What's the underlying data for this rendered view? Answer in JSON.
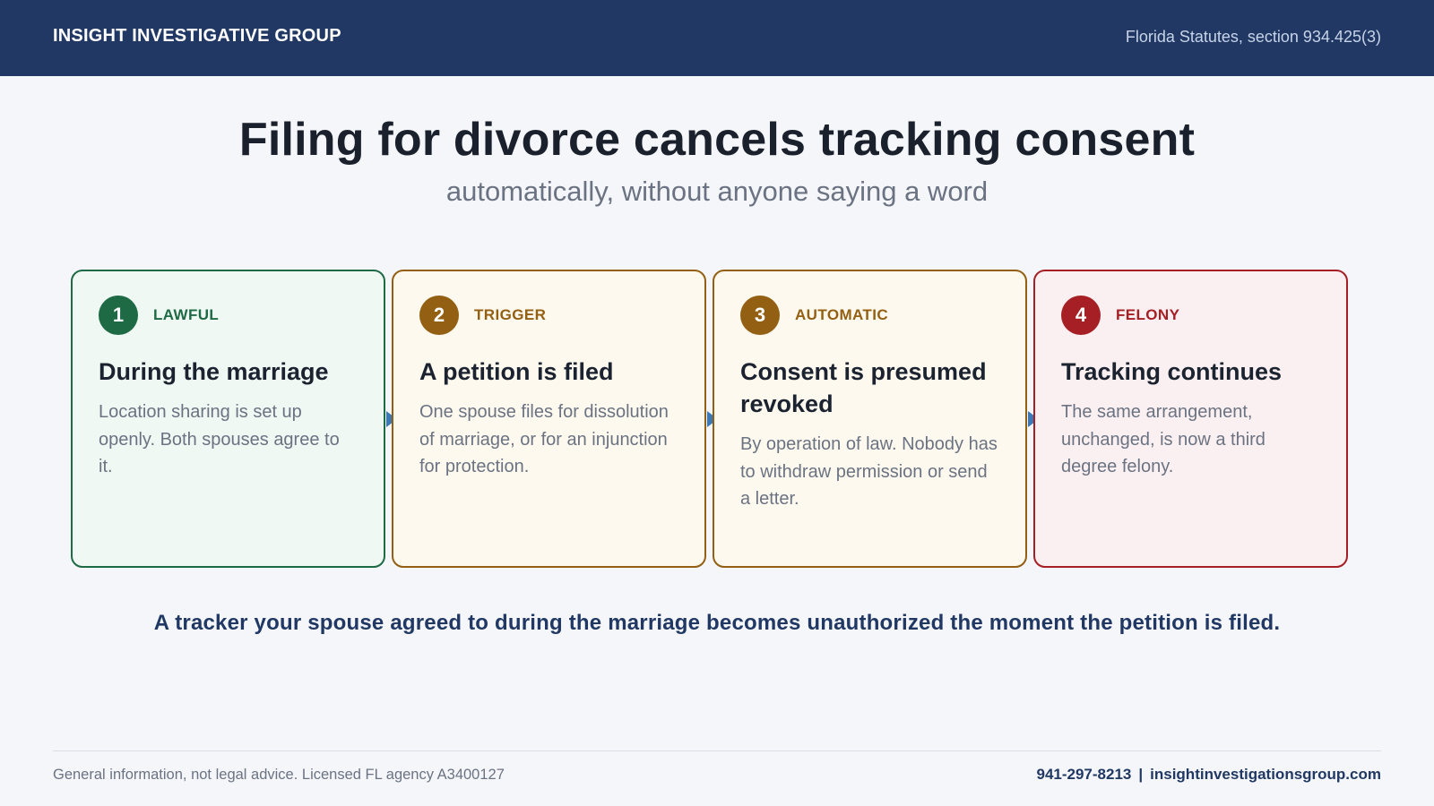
{
  "header": {
    "brand": "INSIGHT INVESTIGATIVE GROUP",
    "statute": "Florida Statutes, section 934.425(3)"
  },
  "title": "Filing for divorce cancels tracking consent",
  "subtitle": "automatically, without anyone saying a word",
  "steps": [
    {
      "number": "1",
      "tag": "LAWFUL",
      "title": "During the marriage",
      "description": "Location sharing is set up openly. Both spouses agree to it.",
      "color": "#1e6a44",
      "background": "#eff8f3"
    },
    {
      "number": "2",
      "tag": "TRIGGER",
      "title": "A petition is filed",
      "description": "One spouse files for dissolution of marriage, or for an injunction for protection.",
      "color": "#935f12",
      "background": "#fdf9ee"
    },
    {
      "number": "3",
      "tag": "AUTOMATIC",
      "title": "Consent is presumed revoked",
      "description": "By operation of law. Nobody has to withdraw permission or send a letter.",
      "color": "#935f12",
      "background": "#fdf9ee"
    },
    {
      "number": "4",
      "tag": "FELONY",
      "title": "Tracking continues",
      "description": "The same arrangement, unchanged, is now a third degree felony.",
      "color": "#a51f24",
      "background": "#fbf0f1"
    }
  ],
  "callout": "A tracker your spouse agreed to during the marriage becomes unauthorized the moment the petition is filed.",
  "footer": {
    "disclaimer": "General information, not legal advice.  Licensed FL agency A3400127",
    "phone": "941-297-8213",
    "separator": "|",
    "website": "insightinvestigationsgroup.com"
  },
  "colors": {
    "header": "#203863",
    "arrow": "#3a78b8"
  }
}
